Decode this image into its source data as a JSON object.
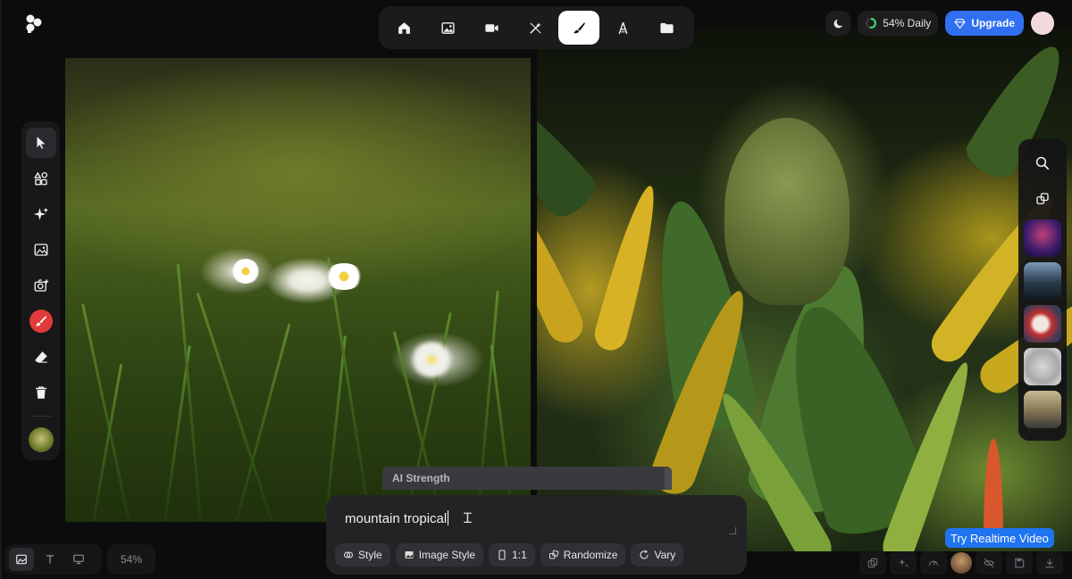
{
  "app": {
    "logo_icon": "clover-logo-icon"
  },
  "top_toolbar": {
    "tools": [
      {
        "name": "home-icon"
      },
      {
        "name": "image-icon"
      },
      {
        "name": "video-icon"
      },
      {
        "name": "magic-wand-icon"
      },
      {
        "name": "brush-icon",
        "active": true
      },
      {
        "name": "text-pen-icon"
      },
      {
        "name": "folder-icon"
      }
    ]
  },
  "header": {
    "theme_icon": "moon-icon",
    "daily_usage": "54% Daily",
    "upgrade_label": "Upgrade",
    "upgrade_icon": "diamond-icon"
  },
  "left_rail": {
    "tools": [
      "select-arrow-icon",
      "shapes-icon",
      "sparkle-icon",
      "image-add-icon",
      "camera-icon",
      "brush-color-icon",
      "eraser-icon",
      "trash-icon",
      "reference-thumbnail"
    ],
    "brush_color": "#e23a3a"
  },
  "right_rail": {
    "tools": [
      "search-icon",
      "layers-icon"
    ],
    "thumbnail_count": 5
  },
  "prompt": {
    "ai_strength_label": "AI Strength",
    "text": "mountain tropical",
    "actions": [
      {
        "label": "Style",
        "icon": "style-icon"
      },
      {
        "label": "Image Style",
        "icon": "image-style-icon"
      },
      {
        "label": "1:1",
        "icon": "aspect-ratio-icon"
      },
      {
        "label": "Randomize",
        "icon": "randomize-icon"
      },
      {
        "label": "Vary",
        "icon": "vary-icon"
      }
    ]
  },
  "bottom_left": {
    "modes": [
      "image-mode-icon",
      "text-mode-icon",
      "screen-mode-icon"
    ],
    "zoom": "54%"
  },
  "bottom_right": {
    "try_realtime_label": "Try Realtime Video"
  },
  "colors": {
    "accent": "#2f6ff0",
    "background": "#0c0c0d",
    "panel": "#1b1b1d"
  }
}
